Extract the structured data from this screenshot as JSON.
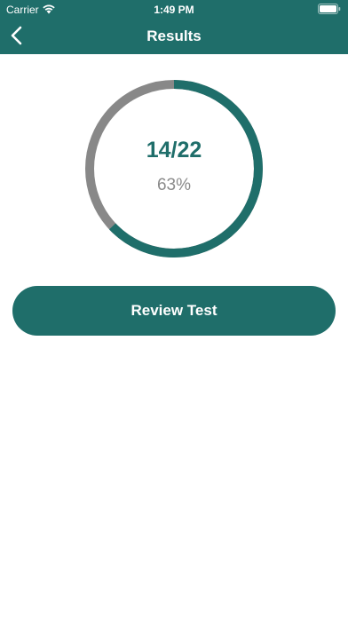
{
  "status_bar": {
    "carrier": "Carrier",
    "time": "1:49 PM"
  },
  "header": {
    "title": "Results",
    "back_icon": "chevron-left-icon"
  },
  "result": {
    "score": "14/22",
    "percent": "63%",
    "correct": 14,
    "total": 22,
    "fraction": 0.63
  },
  "actions": {
    "review_label": "Review Test"
  },
  "colors": {
    "primary": "#1f6e6a",
    "track": "#888888",
    "percent_text": "#8a8a8a"
  }
}
